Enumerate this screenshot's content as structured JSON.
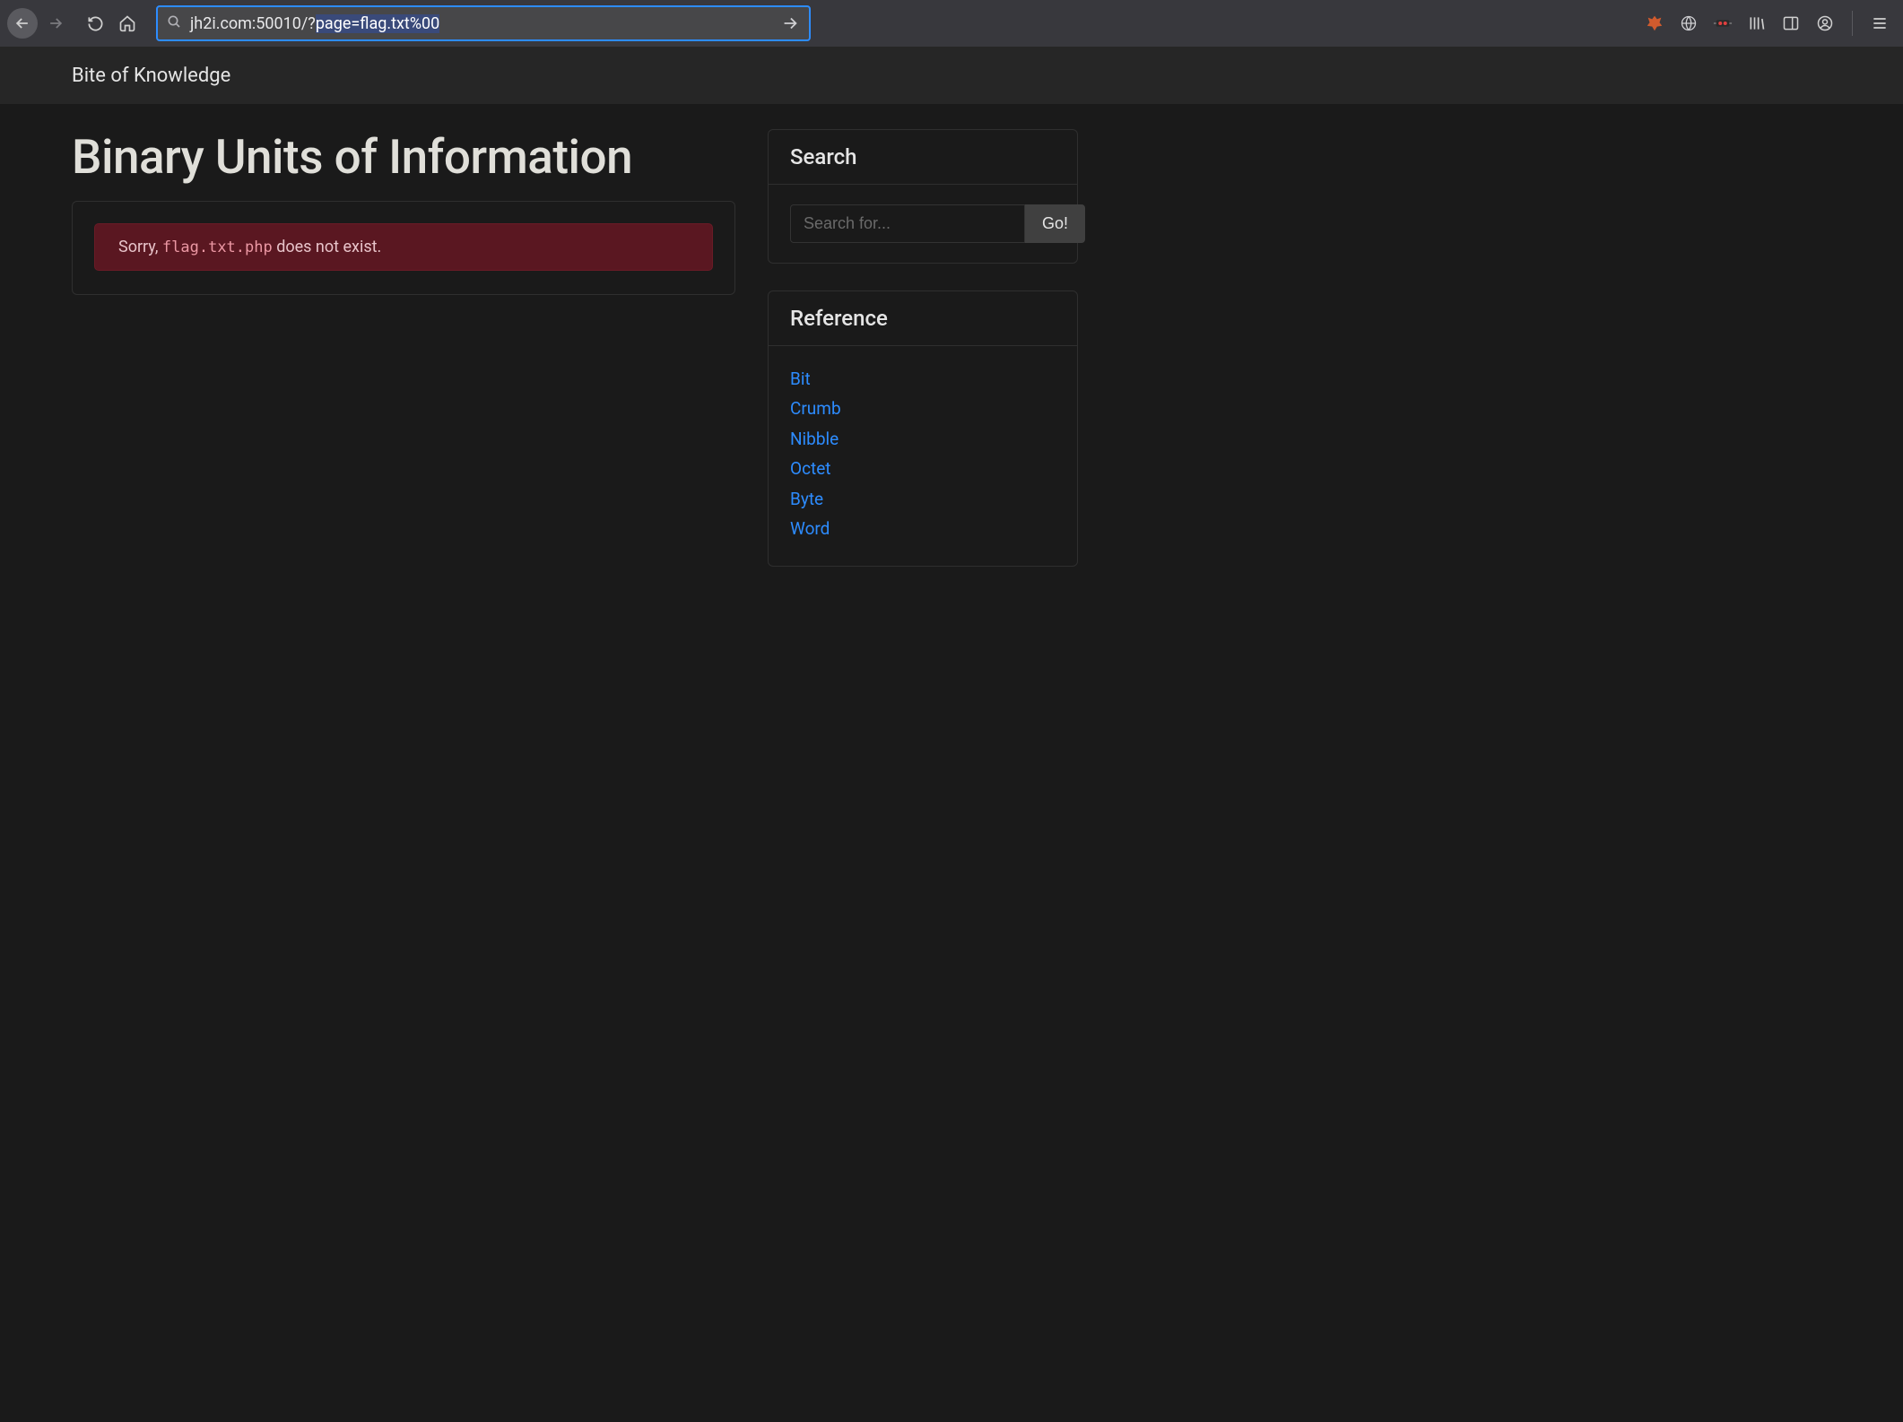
{
  "browser": {
    "url_plain": "jh2i.com:50010/?",
    "url_selected": "page=flag.txt%00"
  },
  "site": {
    "brand": "Bite of Knowledge",
    "title": "Binary Units of Information"
  },
  "alert": {
    "prefix": "Sorry, ",
    "filename": "flag.txt.php",
    "suffix": " does not exist."
  },
  "search": {
    "header": "Search",
    "placeholder": "Search for...",
    "button": "Go!"
  },
  "reference": {
    "header": "Reference",
    "items": [
      "Bit",
      "Crumb",
      "Nibble",
      "Octet",
      "Byte",
      "Word"
    ]
  }
}
